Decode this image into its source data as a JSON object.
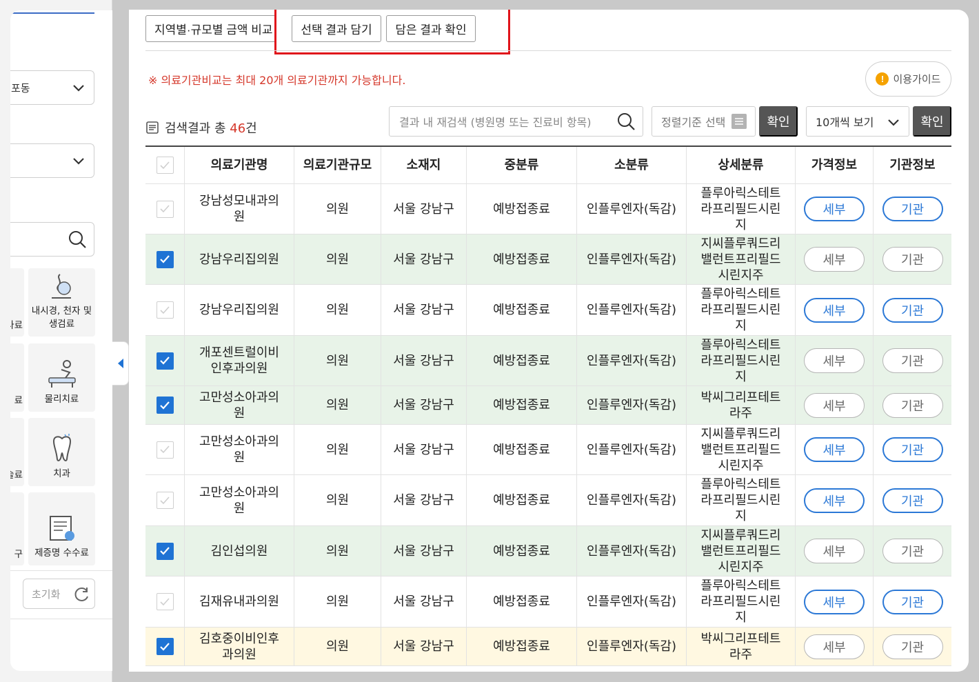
{
  "sidebar": {
    "select1_value": "포동",
    "select2_value": "",
    "partial_tiles": [
      "사료",
      "료",
      "술료",
      "구"
    ],
    "categories": [
      {
        "label": "내시경, 천자 및 생검료",
        "icon": "endoscope-icon"
      },
      {
        "label": "물리치료",
        "icon": "physical-therapy-icon"
      },
      {
        "label": "치과",
        "icon": "tooth-icon"
      },
      {
        "label": "제증명 수수료",
        "icon": "certificate-icon"
      }
    ],
    "reset_label": "초기화"
  },
  "toolbar": {
    "compare_label": "지역별·규모별 금액 비교",
    "add_label": "선택 결과 담기",
    "view_label": "담은 결과 확인"
  },
  "notice": "※ 의료기관비교는 최대 20개 의료기관까지 가능합니다.",
  "guide_label": "이용가이드",
  "result": {
    "prefix": "검색결과 총 ",
    "count": "46",
    "suffix": "건"
  },
  "re_search_placeholder": "결과 내 재검색 (병원명 또는 진료비 항목)",
  "sort_placeholder": "정렬기준 선택",
  "confirm_label": "확인",
  "per_page_value": "10개씩 보기",
  "highlight_color": "#e0141b",
  "table": {
    "headers": [
      "의료기관명",
      "의료기관규모",
      "소재지",
      "중분류",
      "소분류",
      "상세분류",
      "가격정보",
      "기관정보"
    ],
    "detail_label": "세부",
    "inst_label": "기관",
    "rows": [
      {
        "name": "강남성모내과의원",
        "size": "의원",
        "loc": "서울 강남구",
        "mid": "예방접종료",
        "sub": "인플루엔자(독감)",
        "detail": "플루아릭스테트라프리필드시린지",
        "checked": false
      },
      {
        "name": "강남우리집의원",
        "size": "의원",
        "loc": "서울 강남구",
        "mid": "예방접종료",
        "sub": "인플루엔자(독감)",
        "detail": "지씨플루쿼드리밸런트프리필드시린지주",
        "checked": true
      },
      {
        "name": "강남우리집의원",
        "size": "의원",
        "loc": "서울 강남구",
        "mid": "예방접종료",
        "sub": "인플루엔자(독감)",
        "detail": "플루아릭스테트라프리필드시린지",
        "checked": false
      },
      {
        "name": "개포센트럴이비인후과의원",
        "size": "의원",
        "loc": "서울 강남구",
        "mid": "예방접종료",
        "sub": "인플루엔자(독감)",
        "detail": "플루아릭스테트라프리필드시린지",
        "checked": true
      },
      {
        "name": "고만성소아과의원",
        "size": "의원",
        "loc": "서울 강남구",
        "mid": "예방접종료",
        "sub": "인플루엔자(독감)",
        "detail": "박씨그리프테트라주",
        "checked": true
      },
      {
        "name": "고만성소아과의원",
        "size": "의원",
        "loc": "서울 강남구",
        "mid": "예방접종료",
        "sub": "인플루엔자(독감)",
        "detail": "지씨플루쿼드리밸런트프리필드시린지주",
        "checked": false
      },
      {
        "name": "고만성소아과의원",
        "size": "의원",
        "loc": "서울 강남구",
        "mid": "예방접종료",
        "sub": "인플루엔자(독감)",
        "detail": "플루아릭스테트라프리필드시린지",
        "checked": false
      },
      {
        "name": "김인섭의원",
        "size": "의원",
        "loc": "서울 강남구",
        "mid": "예방접종료",
        "sub": "인플루엔자(독감)",
        "detail": "지씨플루쿼드리밸런트프리필드시린지주",
        "checked": true
      },
      {
        "name": "김재유내과의원",
        "size": "의원",
        "loc": "서울 강남구",
        "mid": "예방접종료",
        "sub": "인플루엔자(독감)",
        "detail": "플루아릭스테트라프리필드시린지",
        "checked": false
      },
      {
        "name": "김호중이비인후과의원",
        "size": "의원",
        "loc": "서울 강남구",
        "mid": "예방접종료",
        "sub": "인플루엔자(독감)",
        "detail": "박씨그리프테트라주",
        "checked": true
      }
    ]
  }
}
